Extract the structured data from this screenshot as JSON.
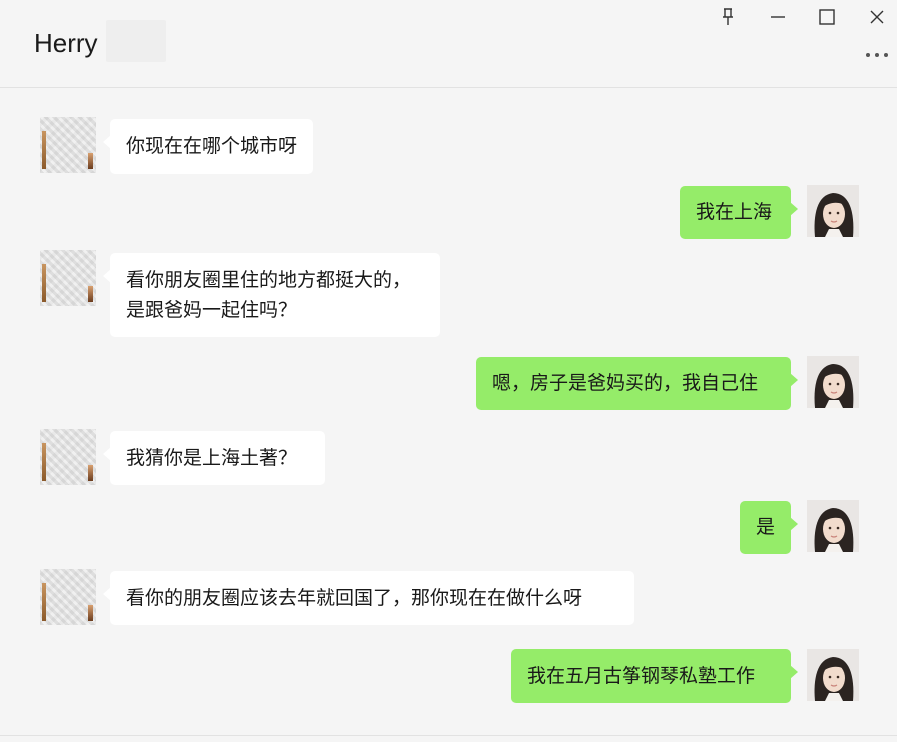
{
  "window": {
    "contact_name": "Herry",
    "pin_icon": "pin-icon",
    "minimize_icon": "minimize-icon",
    "maximize_icon": "maximize-icon",
    "close_icon": "close-icon",
    "more_icon": "more-icon"
  },
  "colors": {
    "background": "#f5f5f5",
    "incoming_bubble": "#ffffff",
    "outgoing_bubble": "#95ec69",
    "text": "#191919"
  },
  "messages": [
    {
      "direction": "in",
      "lines": [
        "你现在在哪个城市呀"
      ]
    },
    {
      "direction": "out",
      "lines": [
        "我在上海"
      ]
    },
    {
      "direction": "in",
      "lines": [
        "看你朋友圈里住的地方都挺大的，",
        "是跟爸妈一起住吗？"
      ]
    },
    {
      "direction": "out",
      "lines": [
        "嗯，房子是爸妈买的，我自己住"
      ]
    },
    {
      "direction": "in",
      "lines": [
        "我猜你是上海土著？"
      ]
    },
    {
      "direction": "out",
      "lines": [
        "是"
      ]
    },
    {
      "direction": "in",
      "lines": [
        "看你的朋友圈应该去年就回国了，那你现在在做什么呀"
      ]
    },
    {
      "direction": "out",
      "lines": [
        "我在五月古筝钢琴私塾工作"
      ]
    }
  ]
}
